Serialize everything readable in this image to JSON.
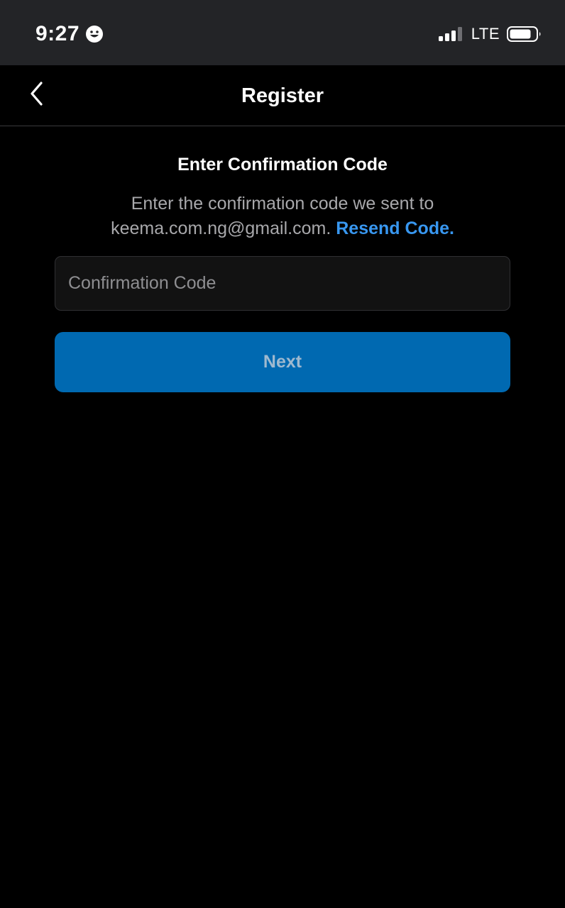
{
  "status_bar": {
    "time": "9:27",
    "network": "LTE",
    "icons": [
      "smiley-face-icon",
      "signal-bars-icon",
      "battery-icon"
    ]
  },
  "nav": {
    "title": "Register",
    "back_icon": "chevron-left-icon"
  },
  "main": {
    "heading": "Enter Confirmation Code",
    "description_line1": "Enter the confirmation code we sent to",
    "email": "keema.com.ng@gmail.com.",
    "resend_link": "Resend Code.",
    "code_input": {
      "value": "",
      "placeholder": "Confirmation Code"
    },
    "next_button": "Next"
  },
  "colors": {
    "background": "#000000",
    "status_bar": "#232427",
    "link": "#3897f0",
    "primary_button": "#0069b1",
    "muted_text": "#a8a8ab"
  }
}
